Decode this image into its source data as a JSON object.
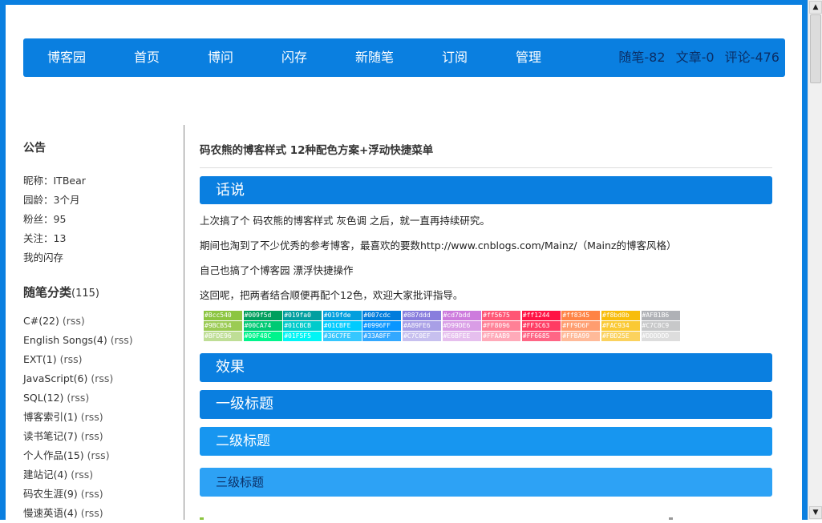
{
  "nav": {
    "items": [
      "博客园",
      "首页",
      "博问",
      "闪存",
      "新随笔",
      "订阅",
      "管理"
    ],
    "stats": {
      "posts": "随笔-82",
      "articles": "文章-0",
      "comments": "评论-476"
    }
  },
  "sidebar": {
    "notice_title": "公告",
    "profile": {
      "nickname": "昵称：ITBear",
      "age": "园龄：3个月",
      "fans": "粉丝：95",
      "follow": "关注：13",
      "flash": "我的闪存"
    },
    "categories_title": "随笔分类",
    "categories_count": "(115)",
    "categories": [
      {
        "name": "C#(22)",
        "rss": "(rss)"
      },
      {
        "name": "English Songs(4)",
        "rss": "(rss)"
      },
      {
        "name": "EXT(1)",
        "rss": "(rss)"
      },
      {
        "name": "JavaScript(6)",
        "rss": "(rss)"
      },
      {
        "name": "SQL(12)",
        "rss": "(rss)"
      },
      {
        "name": "博客索引(1)",
        "rss": "(rss)"
      },
      {
        "name": "读书笔记(7)",
        "rss": "(rss)"
      },
      {
        "name": "个人作品(15)",
        "rss": "(rss)"
      },
      {
        "name": "建站记(4)",
        "rss": "(rss)"
      },
      {
        "name": "码农生涯(9)",
        "rss": "(rss)"
      },
      {
        "name": "慢速英语(4)",
        "rss": "(rss)"
      }
    ]
  },
  "post": {
    "title": "码农熊的博客样式 12种配色方案+浮动快捷菜单",
    "section_intro": "话说",
    "paragraphs": [
      "上次搞了个 码农熊的博客样式 灰色调 之后，就一直再持续研究。",
      "期间也淘到了不少优秀的参考博客，最喜欢的要数http://www.cnblogs.com/Mainz/（Mainz的博客风格）",
      "自己也搞了个博客园 漂浮快捷操作",
      "这回呢，把两者结合顺便再配个12色，欢迎大家批评指导。"
    ],
    "swatch_rows": [
      [
        "#8cc540",
        "#009f5d",
        "#019fa0",
        "#019fde",
        "#007cdc",
        "#887ddd",
        "#cd7bdd",
        "#ff5675",
        "#ff1244",
        "#ff8345",
        "#f8bd0b",
        "#AFB1B6"
      ],
      [
        "#9BCB54",
        "#00CA74",
        "#01CBCB",
        "#01CBFE",
        "#0996FF",
        "#A89FE6",
        "#D99DE6",
        "#FF8096",
        "#FF3C63",
        "#FF9D6F",
        "#FAC934",
        "#C7C8C9"
      ],
      [
        "#BFDE96",
        "#00F48C",
        "#01F5F5",
        "#36C7FE",
        "#33A8FF",
        "#C7C0EF",
        "#E6BFEE",
        "#FFAAB9",
        "#FF6685",
        "#FFBA99",
        "#FBD25E",
        "#DDDDDD"
      ]
    ],
    "section_effect": "效果",
    "h_level1": "一级标题",
    "h_level2": "二级标题",
    "h_level3": "三级标题"
  }
}
